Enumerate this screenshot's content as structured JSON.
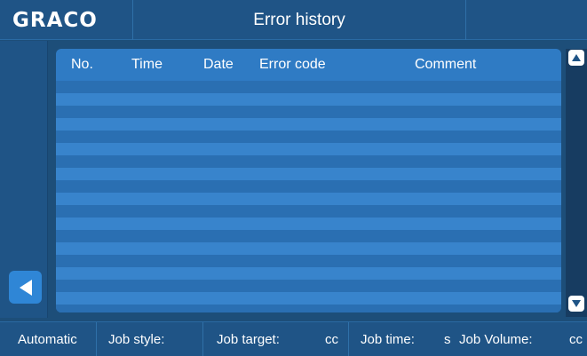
{
  "header": {
    "logo": "GRACO",
    "title": "Error history"
  },
  "table": {
    "columns": [
      "No.",
      "Time",
      "Date",
      "Error code",
      "Comment"
    ],
    "rows": []
  },
  "status_bar": {
    "mode": "Automatic",
    "job_style_label": "Job style:",
    "job_target_label": "Job target:",
    "job_target_unit": "cc",
    "job_time_label": "Job time:",
    "job_time_unit": "s",
    "job_volume_label": "Job Volume:",
    "job_volume_unit": "cc"
  },
  "icons": {
    "back": "left-arrow-icon",
    "scroll_up": "up-arrow-icon",
    "scroll_down": "down-arrow-icon"
  },
  "colors": {
    "background": "#1d4e79",
    "panel": "#2f7bc4",
    "row_dark": "#2a6fb2",
    "row_light": "#3884cc",
    "accent_button": "#2f86d6"
  }
}
